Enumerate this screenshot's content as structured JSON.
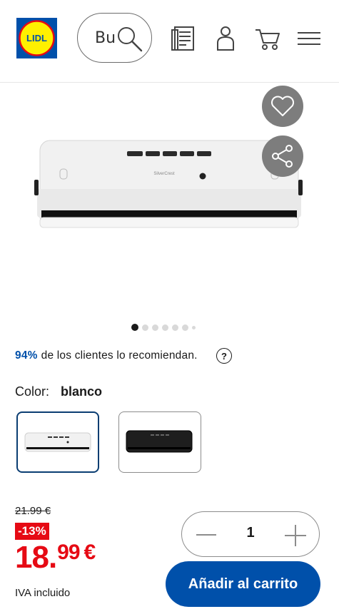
{
  "header": {
    "logo_text": "LIDL",
    "search_placeholder": "Bu",
    "icons": [
      "search-icon",
      "leaflet-icon",
      "user-icon",
      "cart-icon",
      "menu-icon"
    ]
  },
  "gallery": {
    "product_brand": "SilverCrest",
    "favorite_icon": "heart-icon",
    "share_icon": "share-icon",
    "image_count": 6,
    "active_index": 0
  },
  "recommendation": {
    "percent": "94%",
    "text": "de los clientes lo recomiendan.",
    "help_label": "?"
  },
  "color": {
    "label": "Color:",
    "value": "blanco",
    "options": [
      "blanco",
      "negro"
    ]
  },
  "price": {
    "old": "21.99 €",
    "discount": "-13%",
    "main": "18.",
    "decimals": "99",
    "currency": "€",
    "tax_note": "IVA incluido"
  },
  "quantity": {
    "value": "1"
  },
  "cart_button": {
    "label": "Añadir al carrito"
  },
  "colors": {
    "brand_blue": "#0050aa",
    "sale_red": "#e60a14",
    "logo_yellow": "#fff000"
  }
}
